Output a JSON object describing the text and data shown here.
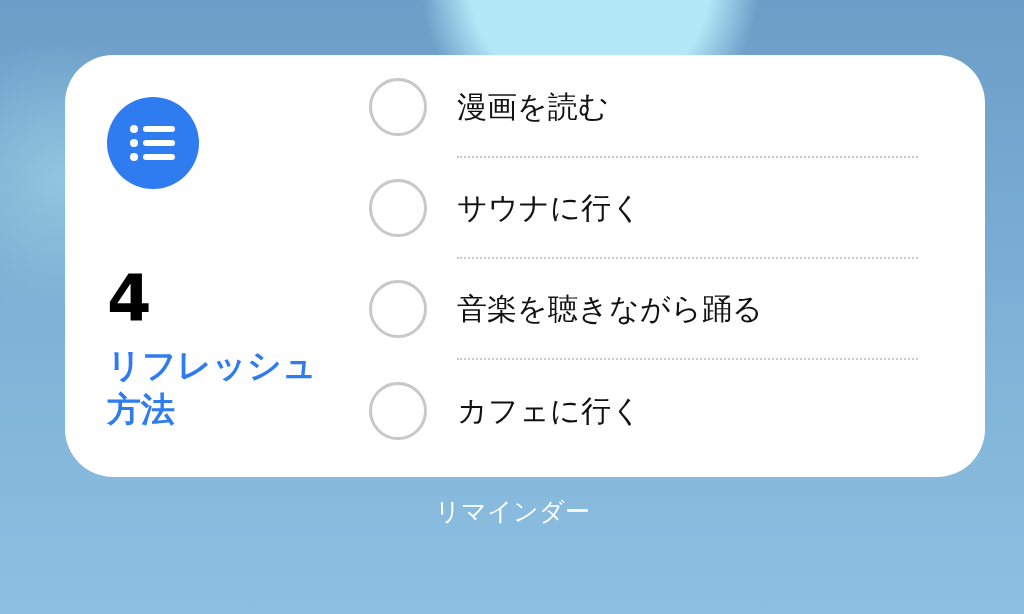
{
  "widget": {
    "count": "4",
    "list_name": "リフレッシュ方法",
    "items": [
      {
        "title": "漫画を読む",
        "checked": false
      },
      {
        "title": "サウナに行く",
        "checked": false
      },
      {
        "title": "音楽を聴きながら踊る",
        "checked": false
      },
      {
        "title": "カフェに行く",
        "checked": false
      }
    ]
  },
  "app_label": "リマインダー"
}
